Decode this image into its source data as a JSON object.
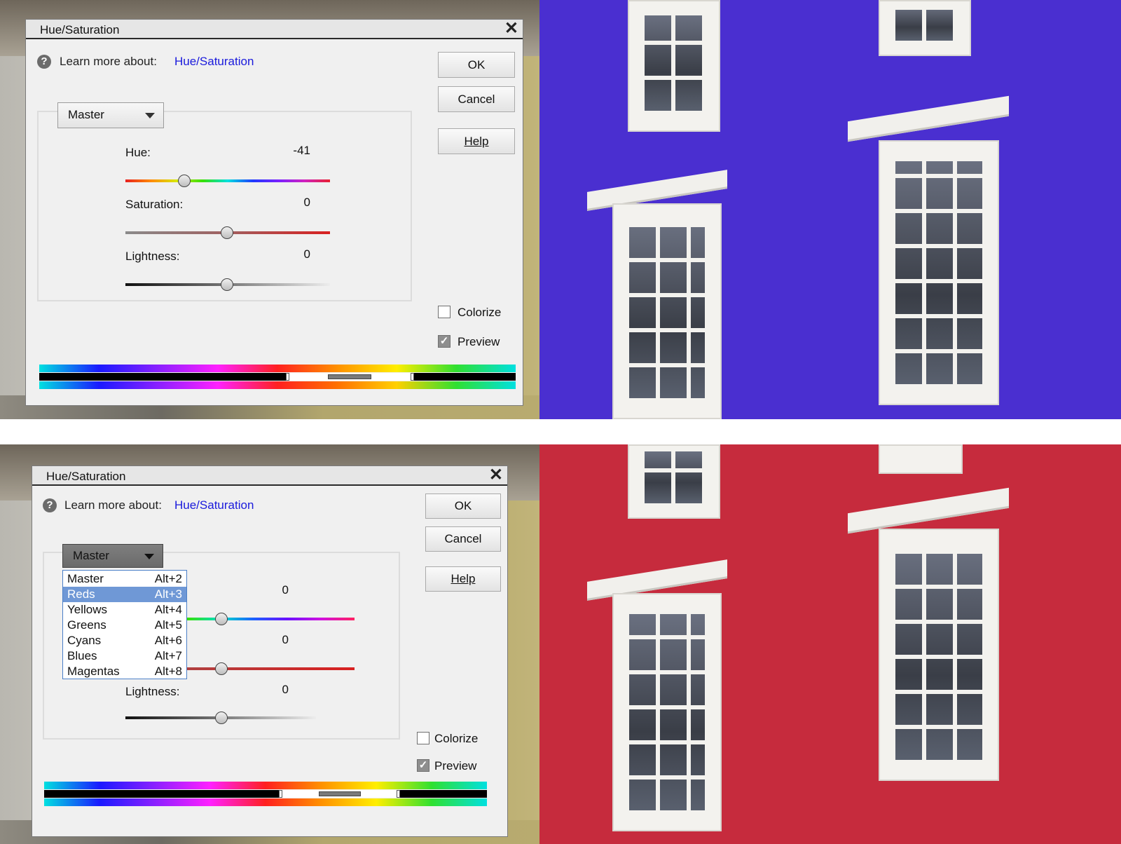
{
  "top": {
    "dialog_title": "Hue/Saturation",
    "learn_prefix": "Learn more about:",
    "learn_link": "Hue/Saturation",
    "ok": "OK",
    "cancel": "Cancel",
    "help": "Help",
    "channel": "Master",
    "hue_label": "Hue:",
    "hue_value": "-41",
    "saturation_label": "Saturation:",
    "saturation_value": "0",
    "lightness_label": "Lightness:",
    "lightness_value": "0",
    "colorize_label": "Colorize",
    "colorize_checked": false,
    "preview_label": "Preview",
    "preview_checked": true
  },
  "bottom": {
    "dialog_title": "Hue/Saturation",
    "learn_prefix": "Learn more about:",
    "learn_link": "Hue/Saturation",
    "ok": "OK",
    "cancel": "Cancel",
    "help": "Help",
    "channel": "Master",
    "hue_value": "0",
    "saturation_value": "0",
    "lightness_label": "Lightness:",
    "lightness_value": "0",
    "colorize_label": "Colorize",
    "colorize_checked": false,
    "preview_label": "Preview",
    "preview_checked": true,
    "menu": [
      {
        "name": "Master",
        "shortcut": "Alt+2"
      },
      {
        "name": "Reds",
        "shortcut": "Alt+3",
        "highlighted": true
      },
      {
        "name": "Yellows",
        "shortcut": "Alt+4"
      },
      {
        "name": "Greens",
        "shortcut": "Alt+5"
      },
      {
        "name": "Cyans",
        "shortcut": "Alt+6"
      },
      {
        "name": "Blues",
        "shortcut": "Alt+7"
      },
      {
        "name": "Magentas",
        "shortcut": "Alt+8"
      }
    ]
  },
  "colors": {
    "wall_top": "#4a2fd0",
    "wall_bottom": "#c62b3d",
    "link": "#1a1adc",
    "menu_highlight": "#6f98d6"
  }
}
